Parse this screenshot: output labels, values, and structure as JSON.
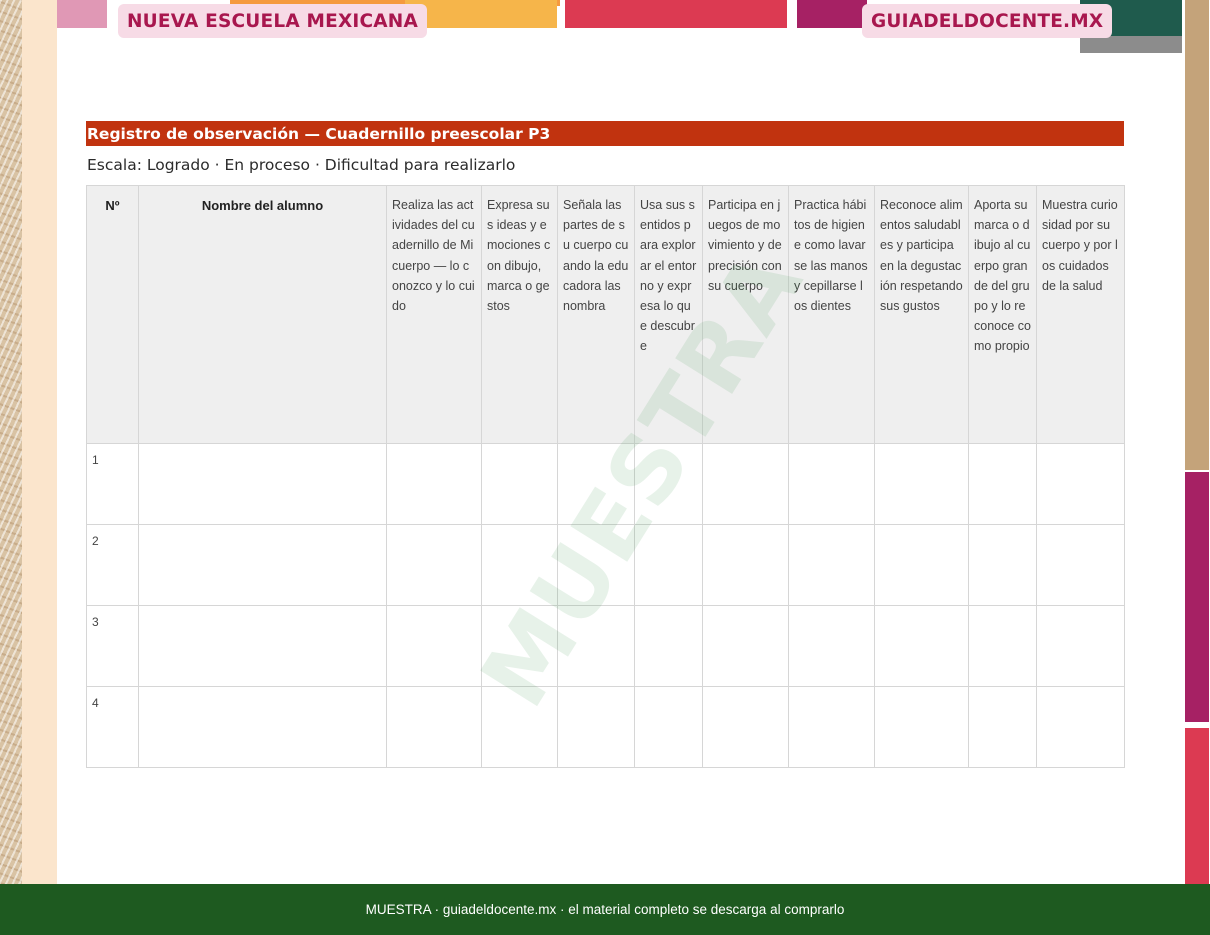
{
  "header": {
    "badge_left": "NUEVA ESCUELA MEXICANA",
    "badge_right": "GUIADELDOCENTE.MX"
  },
  "document": {
    "title": "Registro de observación — Cuadernillo preescolar P3",
    "scale": "Escala: Logrado · En proceso · Dificultad para realizarlo"
  },
  "table": {
    "headers": [
      "Nº",
      "Nombre del alumno",
      "Realiza las actividades del cuadernillo de Mi cuerpo — lo conozco y lo cuido",
      "Expresa sus ideas y emociones con dibujo, marca o gestos",
      "Señala las partes de su cuerpo cuando la educadora las nombra",
      "Usa sus sentidos para explorar el entorno y expresa lo que descubre",
      "Participa en juegos de movimiento y de precisión con su cuerpo",
      "Practica hábitos de higiene como lavarse las manos y cepillarse los dientes",
      "Reconoce alimentos saludables y participa en la degustación respetando sus gustos",
      "Aporta su marca o dibujo al cuerpo grande del grupo y lo reconoce como propio",
      "Muestra curiosidad por su cuerpo y por los cuidados de la salud"
    ],
    "rows": [
      "1",
      "2",
      "3",
      "4"
    ]
  },
  "watermark": "MUESTRA",
  "footer": {
    "text": "MUESTRA · guiadeldocente.mx · el material completo se descarga al comprarlo"
  },
  "colors": {
    "title_bar": "#c1330f",
    "footer": "#1e5a20",
    "badge_text": "#a8174e",
    "badge_bg": "#f7dbe6"
  }
}
